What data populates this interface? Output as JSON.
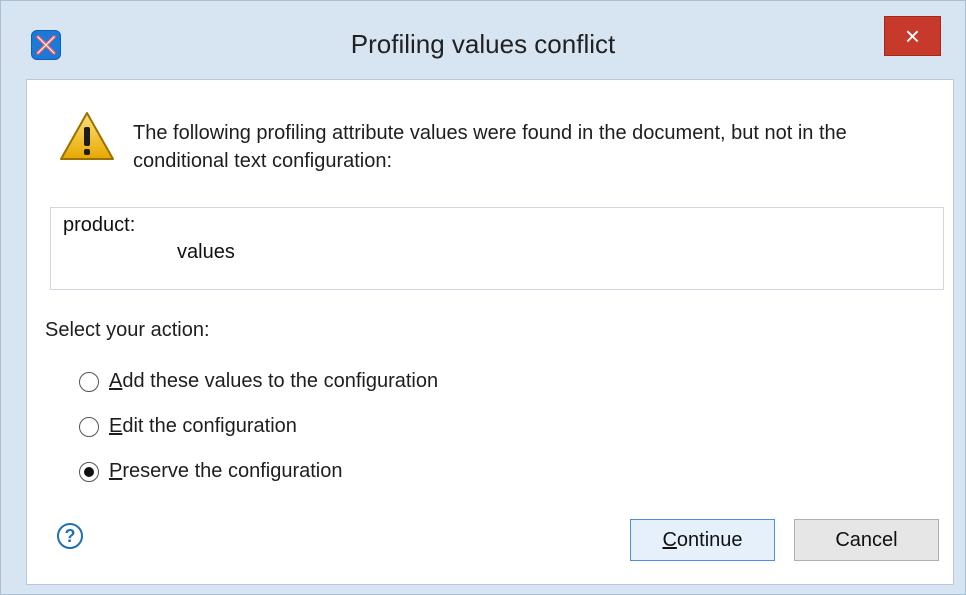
{
  "window": {
    "title": "Profiling values conflict",
    "close_label": "×"
  },
  "message": {
    "text": "The following profiling attribute values were found in the document, but not in the conditional text configuration:"
  },
  "conflicts": {
    "key_label": "product:",
    "values_label": "values"
  },
  "actions": {
    "label": "Select your action:",
    "options": [
      {
        "mnemonic": "A",
        "rest": "dd these values to the configuration",
        "selected": false
      },
      {
        "mnemonic": "E",
        "rest": "dit the configuration",
        "selected": false
      },
      {
        "mnemonic": "P",
        "rest": "reserve the configuration",
        "selected": true
      }
    ]
  },
  "footer": {
    "help_symbol": "?",
    "continue": {
      "mnemonic": "C",
      "rest": "ontinue"
    },
    "cancel_label": "Cancel"
  },
  "icons": {
    "app": "oxygen-app-icon",
    "warning": "warning-triangle-icon",
    "help": "help-icon",
    "close": "close-icon"
  }
}
